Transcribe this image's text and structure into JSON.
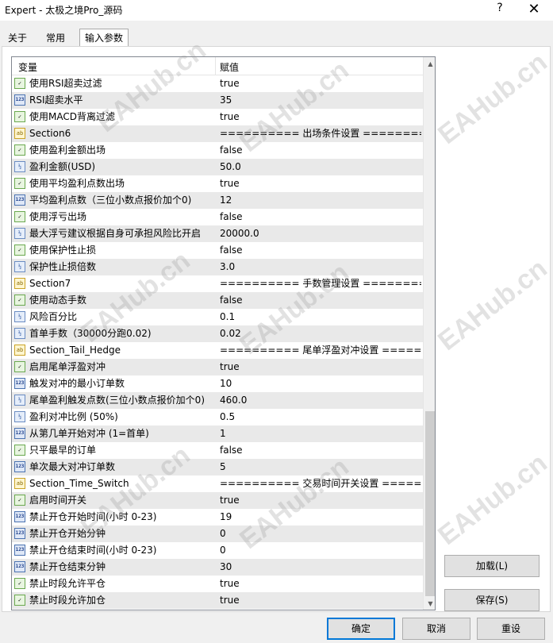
{
  "window": {
    "title": "Expert - 太极之境Pro_源码",
    "help_glyph": "?",
    "close_glyph": "✕"
  },
  "tabs": [
    {
      "label": "关于"
    },
    {
      "label": "常用"
    },
    {
      "label": "输入参数",
      "active": true
    }
  ],
  "grid": {
    "col_variable": "变量",
    "col_value": "赋值",
    "rows": [
      {
        "type": "bool",
        "name": "使用RSI超卖过滤",
        "value": "true"
      },
      {
        "type": "int",
        "name": "RSI超卖水平",
        "value": "35"
      },
      {
        "type": "bool",
        "name": "使用MACD背离过滤",
        "value": "true"
      },
      {
        "type": "string",
        "name": "Section6",
        "value": "========== 出场条件设置 ========="
      },
      {
        "type": "bool",
        "name": "使用盈利金额出场",
        "value": "false"
      },
      {
        "type": "double",
        "name": "盈利金额(USD)",
        "value": "50.0"
      },
      {
        "type": "bool",
        "name": "使用平均盈利点数出场",
        "value": "true"
      },
      {
        "type": "int",
        "name": "平均盈利点数（三位小数点报价加个0)",
        "value": "12"
      },
      {
        "type": "bool",
        "name": "使用浮亏出场",
        "value": "false"
      },
      {
        "type": "double",
        "name": "最大浮亏建议根据自身可承担风险比开启",
        "value": "20000.0"
      },
      {
        "type": "bool",
        "name": "使用保护性止损",
        "value": "false"
      },
      {
        "type": "double",
        "name": "保护性止损倍数",
        "value": "3.0"
      },
      {
        "type": "string",
        "name": "Section7",
        "value": "========== 手数管理设置 ========="
      },
      {
        "type": "bool",
        "name": "使用动态手数",
        "value": "false"
      },
      {
        "type": "double",
        "name": "风险百分比",
        "value": "0.1"
      },
      {
        "type": "double",
        "name": "首单手数（30000分跑0.02)",
        "value": "0.02"
      },
      {
        "type": "string",
        "name": "Section_Tail_Hedge",
        "value": "========== 尾单浮盈对冲设置 ========="
      },
      {
        "type": "bool",
        "name": "启用尾单浮盈对冲",
        "value": "true"
      },
      {
        "type": "int",
        "name": "触发对冲的最小订单数",
        "value": "10"
      },
      {
        "type": "double",
        "name": "尾单盈利触发点数(三位小数点报价加个0)",
        "value": "460.0"
      },
      {
        "type": "double",
        "name": "盈利对冲比例 (50%)",
        "value": "0.5"
      },
      {
        "type": "int",
        "name": "从第几单开始对冲 (1=首单)",
        "value": "1"
      },
      {
        "type": "bool",
        "name": "只平最早的订单",
        "value": "false"
      },
      {
        "type": "int",
        "name": "单次最大对冲订单数",
        "value": "5"
      },
      {
        "type": "string",
        "name": "Section_Time_Switch",
        "value": "========== 交易时间开关设置 ========="
      },
      {
        "type": "bool",
        "name": "启用时间开关",
        "value": "true"
      },
      {
        "type": "int",
        "name": "禁止开仓开始时间(小时 0-23)",
        "value": "19"
      },
      {
        "type": "int",
        "name": "禁止开仓开始分钟",
        "value": "0"
      },
      {
        "type": "int",
        "name": "禁止开仓结束时间(小时 0-23)",
        "value": "0"
      },
      {
        "type": "int",
        "name": "禁止开仓结束分钟",
        "value": "30"
      },
      {
        "type": "bool",
        "name": "禁止时段允许平仓",
        "value": "true"
      },
      {
        "type": "bool",
        "name": "禁止时段允许加仓",
        "value": "true"
      }
    ]
  },
  "icons": {
    "bool": "bool-check-icon",
    "int": "int-123-icon",
    "double": "double-v2-icon",
    "string": "string-ab-icon"
  },
  "icon_glyphs": {
    "int": "123",
    "double": "½",
    "string": "ab",
    "bool": "✓"
  },
  "side_buttons": {
    "load": "加载(L)",
    "save": "保存(S)"
  },
  "footer_buttons": {
    "ok": "确定",
    "cancel": "取消",
    "reset": "重设"
  },
  "watermark": "EAHub.cn"
}
